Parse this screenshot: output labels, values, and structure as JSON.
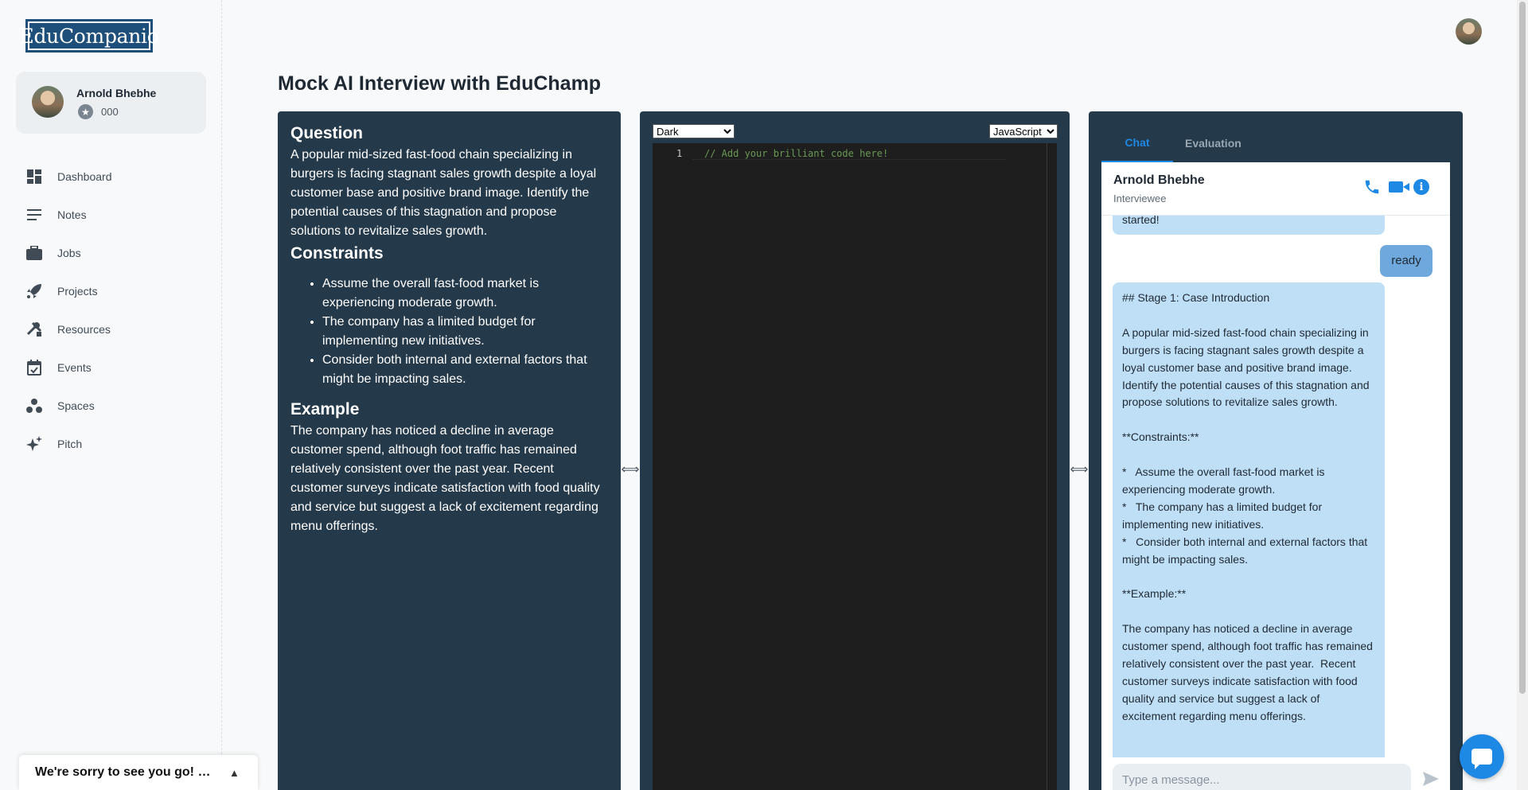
{
  "app": {
    "logo_text": "EduCompanio"
  },
  "profile": {
    "name": "Arnold Bhebhe",
    "points": "000"
  },
  "sidebar": {
    "items": [
      {
        "label": "Dashboard",
        "icon": "dashboard-icon",
        "glyph": "▦"
      },
      {
        "label": "Notes",
        "icon": "notes-icon",
        "glyph": "≡"
      },
      {
        "label": "Jobs",
        "icon": "briefcase-icon",
        "glyph": "▬"
      },
      {
        "label": "Projects",
        "icon": "rocket-icon",
        "glyph": "➶"
      },
      {
        "label": "Resources",
        "icon": "tools-icon",
        "glyph": "✕"
      },
      {
        "label": "Events",
        "icon": "calendar-icon",
        "glyph": "▣"
      },
      {
        "label": "Spaces",
        "icon": "spaces-icon",
        "glyph": "⁂"
      },
      {
        "label": "Pitch",
        "icon": "sparkle-icon",
        "glyph": "✦"
      }
    ]
  },
  "feedback": {
    "text": "We're sorry to see you go! What made you leave?"
  },
  "page": {
    "title": "Mock AI Interview with EduChamp"
  },
  "question": {
    "question_heading": "Question",
    "question_text": "A popular mid-sized fast-food chain specializing in burgers is facing stagnant sales growth despite a loyal customer base and positive brand image. Identify the potential causes of this stagnation and propose solutions to revitalize sales growth.",
    "constraints_heading": "Constraints",
    "constraints": [
      "Assume the overall fast-food market is experiencing moderate growth.",
      "The company has a limited budget for implementing new initiatives.",
      "Consider both internal and external factors that might be impacting sales."
    ],
    "example_heading": "Example",
    "example_text": "The company has noticed a decline in average customer spend, although foot traffic has remained relatively consistent over the past year. Recent customer surveys indicate satisfaction with food quality and service but suggest a lack of excitement regarding menu offerings."
  },
  "editor": {
    "theme": "Dark",
    "language": "JavaScript",
    "line_number": "1",
    "code": "// Add your brilliant code here!"
  },
  "chat": {
    "tabs": [
      "Chat",
      "Evaluation"
    ],
    "contact_name": "Arnold Bhebhe",
    "contact_role": "Interviewee",
    "messages": {
      "top_fragment": "started!",
      "user_ready": "ready",
      "case_intro": "## Stage 1: Case Introduction\n\nA popular mid-sized fast-food chain specializing in burgers is facing stagnant sales growth despite a loyal customer base and positive brand image.  Identify the potential causes of this stagnation and propose solutions to revitalize sales growth.\n\n**Constraints:**\n\n*   Assume the overall fast-food market is experiencing moderate growth.\n*   The company has a limited budget for implementing new initiatives.\n*   Consider both internal and external factors that might be impacting sales.\n\n**Example:**\n\nThe company has noticed a decline in average customer spend, although foot traffic has remained relatively consistent over the past year.  Recent customer surveys indicate satisfaction with food quality and service but suggest a lack of excitement regarding menu offerings."
    },
    "input_placeholder": "Type a message..."
  },
  "colors": {
    "panel_bg": "#24394a",
    "accent": "#1e88e5",
    "bot_bubble": "#bfdff6",
    "user_bubble": "#6fa8dc"
  }
}
